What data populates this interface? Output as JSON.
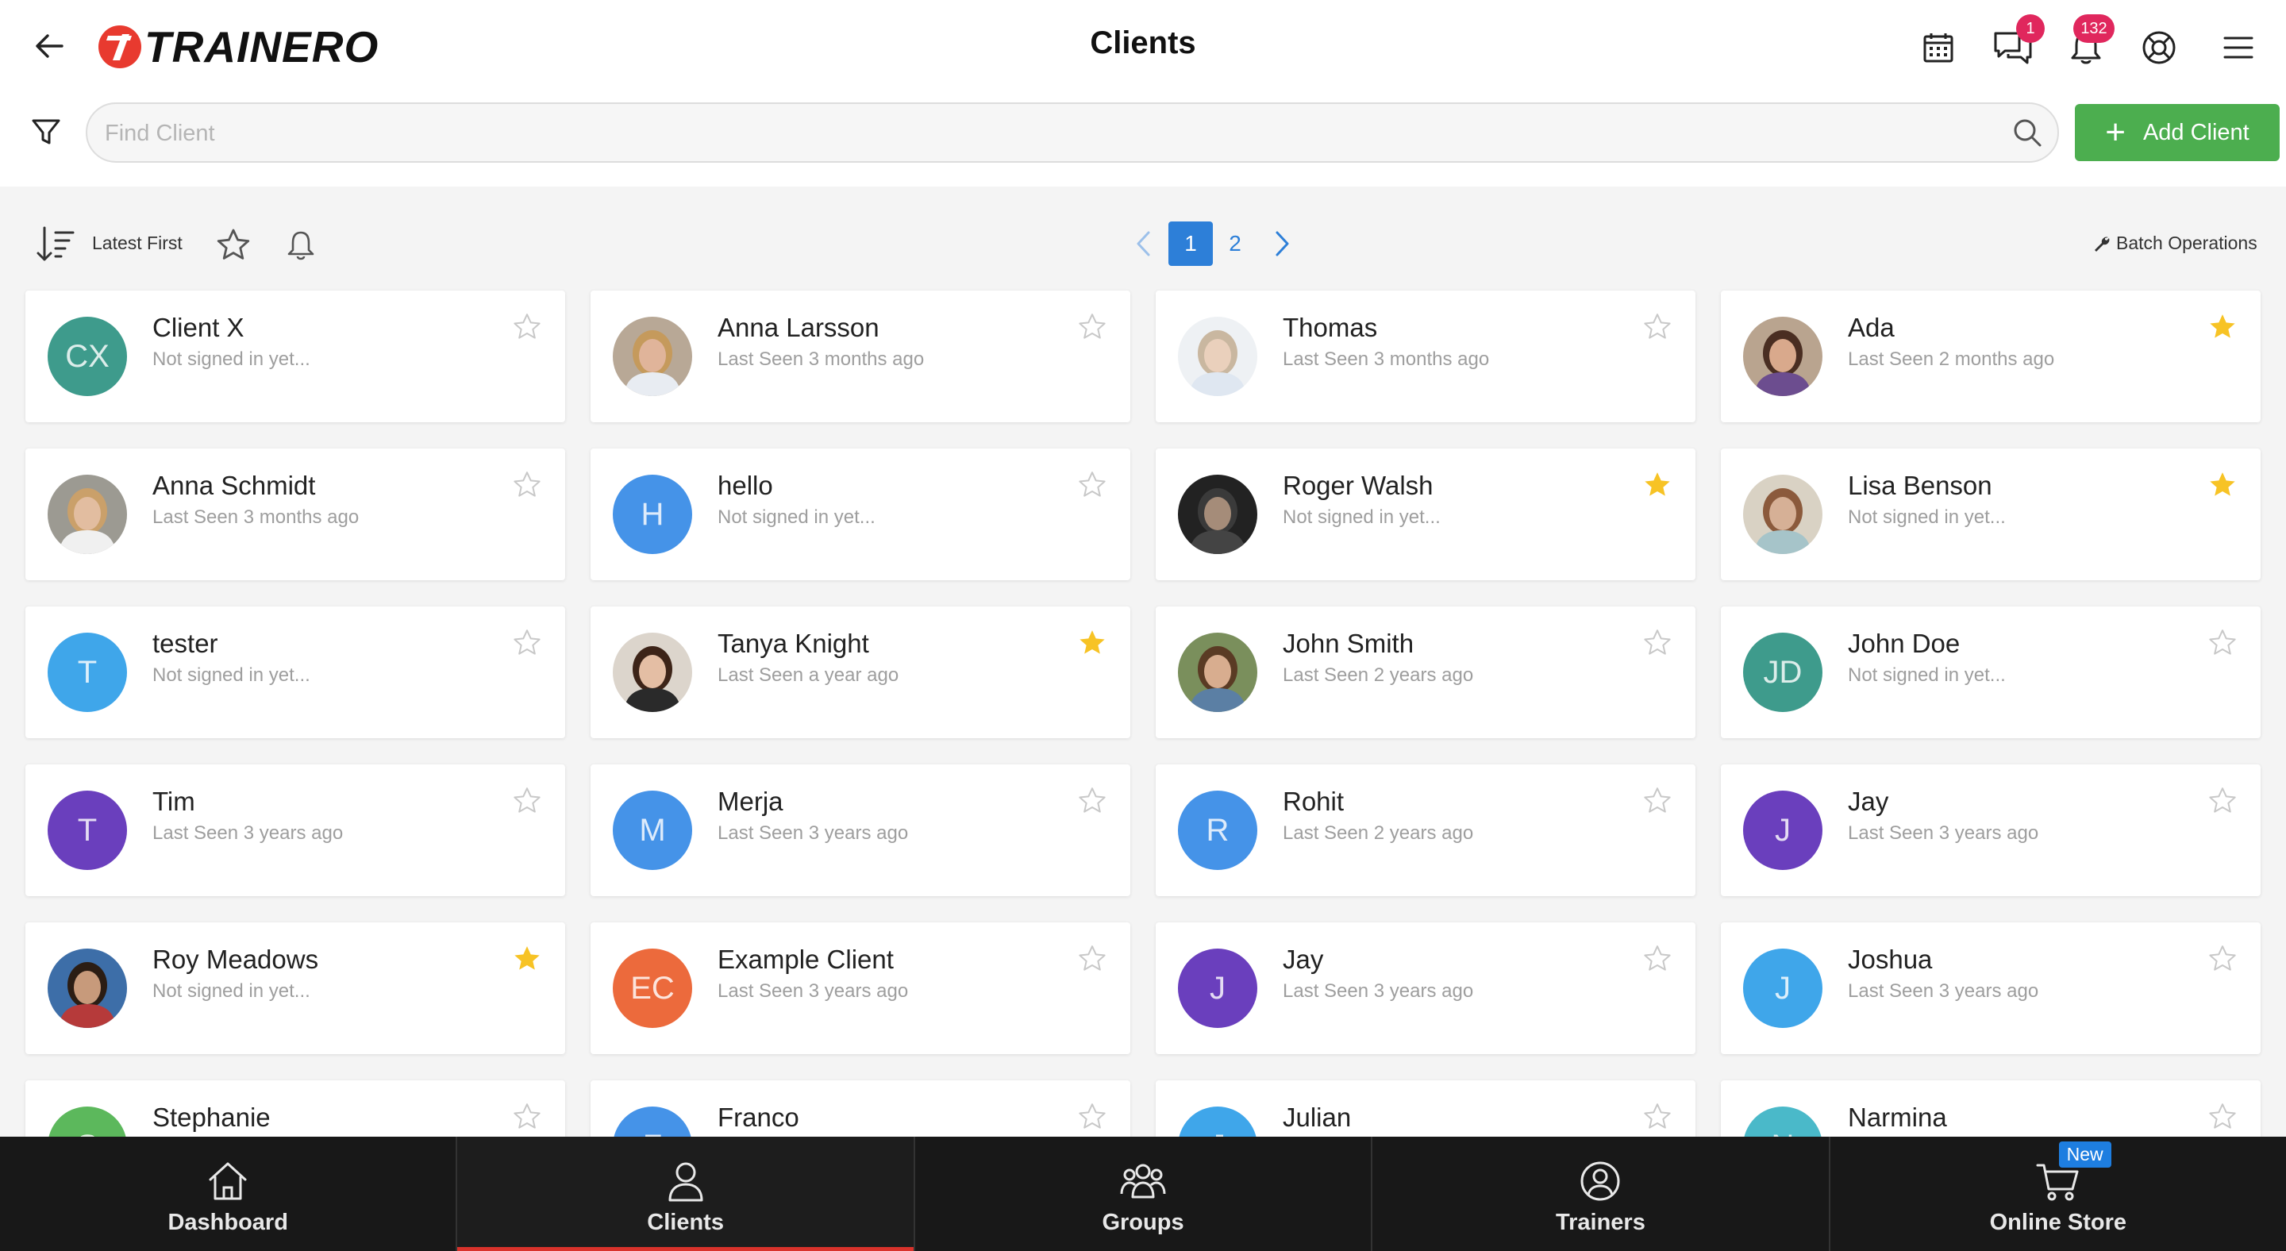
{
  "app": {
    "logo_text": "TRAINERO",
    "page_title": "Clients"
  },
  "header": {
    "messages_badge": "1",
    "notifications_badge": "132"
  },
  "search": {
    "placeholder": "Find Client"
  },
  "add_button": {
    "label": "Add Client"
  },
  "toolbar": {
    "sort_label": "Latest First",
    "batch_label": "Batch Operations"
  },
  "pagination": {
    "pages": [
      "1",
      "2"
    ],
    "current": "1"
  },
  "colors": {
    "accent_green": "#4cae4f",
    "accent_blue": "#2d7fd8",
    "star_active": "#f7c325",
    "brand_red": "#e83a2f"
  },
  "clients": [
    {
      "name": "Client X",
      "status": "Not signed in yet...",
      "initials": "CX",
      "avatar_color": "#3e9b8c",
      "starred": false
    },
    {
      "name": "Anna Larsson",
      "status": "Last Seen 3 months ago",
      "initials": "",
      "avatar_color": "",
      "starred": false
    },
    {
      "name": "Thomas",
      "status": "Last Seen 3 months ago",
      "initials": "",
      "avatar_color": "",
      "starred": false
    },
    {
      "name": "Ada",
      "status": "Last Seen 2 months ago",
      "initials": "",
      "avatar_color": "",
      "starred": true
    },
    {
      "name": "Anna Schmidt",
      "status": "Last Seen 3 months ago",
      "initials": "",
      "avatar_color": "",
      "starred": false
    },
    {
      "name": "hello",
      "status": "Not signed in yet...",
      "initials": "H",
      "avatar_color": "#4593e8",
      "starred": false
    },
    {
      "name": "Roger Walsh",
      "status": "Not signed in yet...",
      "initials": "",
      "avatar_color": "",
      "starred": true
    },
    {
      "name": "Lisa Benson",
      "status": "Not signed in yet...",
      "initials": "",
      "avatar_color": "",
      "starred": true
    },
    {
      "name": "tester",
      "status": "Not signed in yet...",
      "initials": "T",
      "avatar_color": "#3fa6ea",
      "starred": false
    },
    {
      "name": "Tanya Knight",
      "status": "Last Seen a year ago",
      "initials": "",
      "avatar_color": "",
      "starred": true
    },
    {
      "name": "John Smith",
      "status": "Last Seen 2 years ago",
      "initials": "",
      "avatar_color": "",
      "starred": false
    },
    {
      "name": "John Doe",
      "status": "Not signed in yet...",
      "initials": "JD",
      "avatar_color": "#3e9b8c",
      "starred": false
    },
    {
      "name": "Tim",
      "status": "Last Seen 3 years ago",
      "initials": "T",
      "avatar_color": "#6a3fbd",
      "starred": false
    },
    {
      "name": "Merja",
      "status": "Last Seen 3 years ago",
      "initials": "M",
      "avatar_color": "#4593e8",
      "starred": false
    },
    {
      "name": "Rohit",
      "status": "Last Seen 2 years ago",
      "initials": "R",
      "avatar_color": "#4593e8",
      "starred": false
    },
    {
      "name": "Jay",
      "status": "Last Seen 3 years ago",
      "initials": "J",
      "avatar_color": "#6a3fbd",
      "starred": false
    },
    {
      "name": "Roy Meadows",
      "status": "Not signed in yet...",
      "initials": "",
      "avatar_color": "",
      "starred": true
    },
    {
      "name": "Example Client",
      "status": "Last Seen 3 years ago",
      "initials": "EC",
      "avatar_color": "#ec6a3c",
      "starred": false
    },
    {
      "name": "Jay",
      "status": "Last Seen 3 years ago",
      "initials": "J",
      "avatar_color": "#6a3fbd",
      "starred": false
    },
    {
      "name": "Joshua",
      "status": "Last Seen 3 years ago",
      "initials": "J",
      "avatar_color": "#3fa6ea",
      "starred": false
    },
    {
      "name": "Stephanie",
      "status": "",
      "initials": "S",
      "avatar_color": "#5cb85c",
      "starred": false
    },
    {
      "name": "Franco",
      "status": "",
      "initials": "F",
      "avatar_color": "#4593e8",
      "starred": false
    },
    {
      "name": "Julian",
      "status": "",
      "initials": "J",
      "avatar_color": "#3fa6ea",
      "starred": false
    },
    {
      "name": "Narmina",
      "status": "",
      "initials": "N",
      "avatar_color": "#4ab9c9",
      "starred": false
    }
  ],
  "bottom_nav": {
    "items": [
      {
        "label": "Dashboard",
        "icon": "home-icon"
      },
      {
        "label": "Clients",
        "icon": "user-icon",
        "active": true
      },
      {
        "label": "Groups",
        "icon": "group-icon"
      },
      {
        "label": "Trainers",
        "icon": "trainer-icon"
      },
      {
        "label": "Online Store",
        "icon": "cart-icon",
        "badge": "New"
      }
    ]
  }
}
